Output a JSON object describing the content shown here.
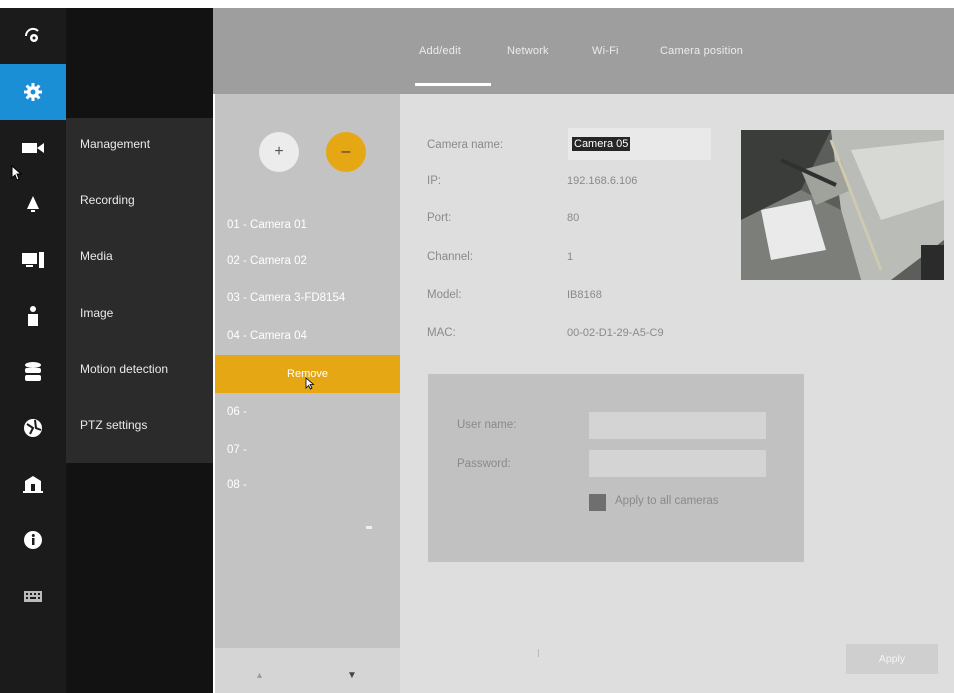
{
  "rail": {
    "items": [
      {
        "icon": "logo-icon"
      },
      {
        "icon": "gear-icon"
      },
      {
        "icon": "video-camera-icon"
      },
      {
        "icon": "bell-icon"
      },
      {
        "icon": "monitor-icon"
      },
      {
        "icon": "person-icon"
      },
      {
        "icon": "database-icon"
      },
      {
        "icon": "globe-icon"
      },
      {
        "icon": "building-icon"
      },
      {
        "icon": "info-icon"
      },
      {
        "icon": "keyboard-icon"
      }
    ],
    "active_color": "#1a8fd6"
  },
  "submenu": {
    "items": [
      {
        "label": "Management"
      },
      {
        "label": "Recording"
      },
      {
        "label": "Media"
      },
      {
        "label": "Image"
      },
      {
        "label": "Motion detection"
      },
      {
        "label": "PTZ settings"
      }
    ]
  },
  "tabs": [
    {
      "label": "Add/edit"
    },
    {
      "label": "Network"
    },
    {
      "label": "Wi-Fi"
    },
    {
      "label": "Camera position"
    }
  ],
  "camera_list": {
    "add_label": "+",
    "remove_label": "–",
    "items": [
      {
        "label": "01 - Camera 01"
      },
      {
        "label": "02 - Camera 02"
      },
      {
        "label": "03 - Camera 3-FD8154"
      },
      {
        "label": "04 - Camera 04"
      },
      {
        "label": "Remove"
      },
      {
        "label": "06 -"
      },
      {
        "label": "07 -"
      },
      {
        "label": "08 -"
      }
    ]
  },
  "details": {
    "camera_name_label": "Camera name:",
    "camera_name_value": "Camera 05",
    "ip_label": "IP:",
    "ip_value": "192.168.6.106",
    "port_label": "Port:",
    "port_value": "80",
    "channel_label": "Channel:",
    "channel_value": "1",
    "model_label": "Model:",
    "model_value": "IB8168",
    "mac_label": "MAC:",
    "mac_value": "00-02-D1-29-A5-C9"
  },
  "credentials": {
    "username_label": "User name:",
    "password_label": "Password:",
    "username_value": "",
    "password_value": "",
    "apply_all_label": "Apply to all cameras"
  },
  "apply_label": "Apply",
  "colors": {
    "accent_orange": "#e6a714",
    "rail_bg": "#1b1b1b",
    "header_bg": "#9e9e9e"
  }
}
